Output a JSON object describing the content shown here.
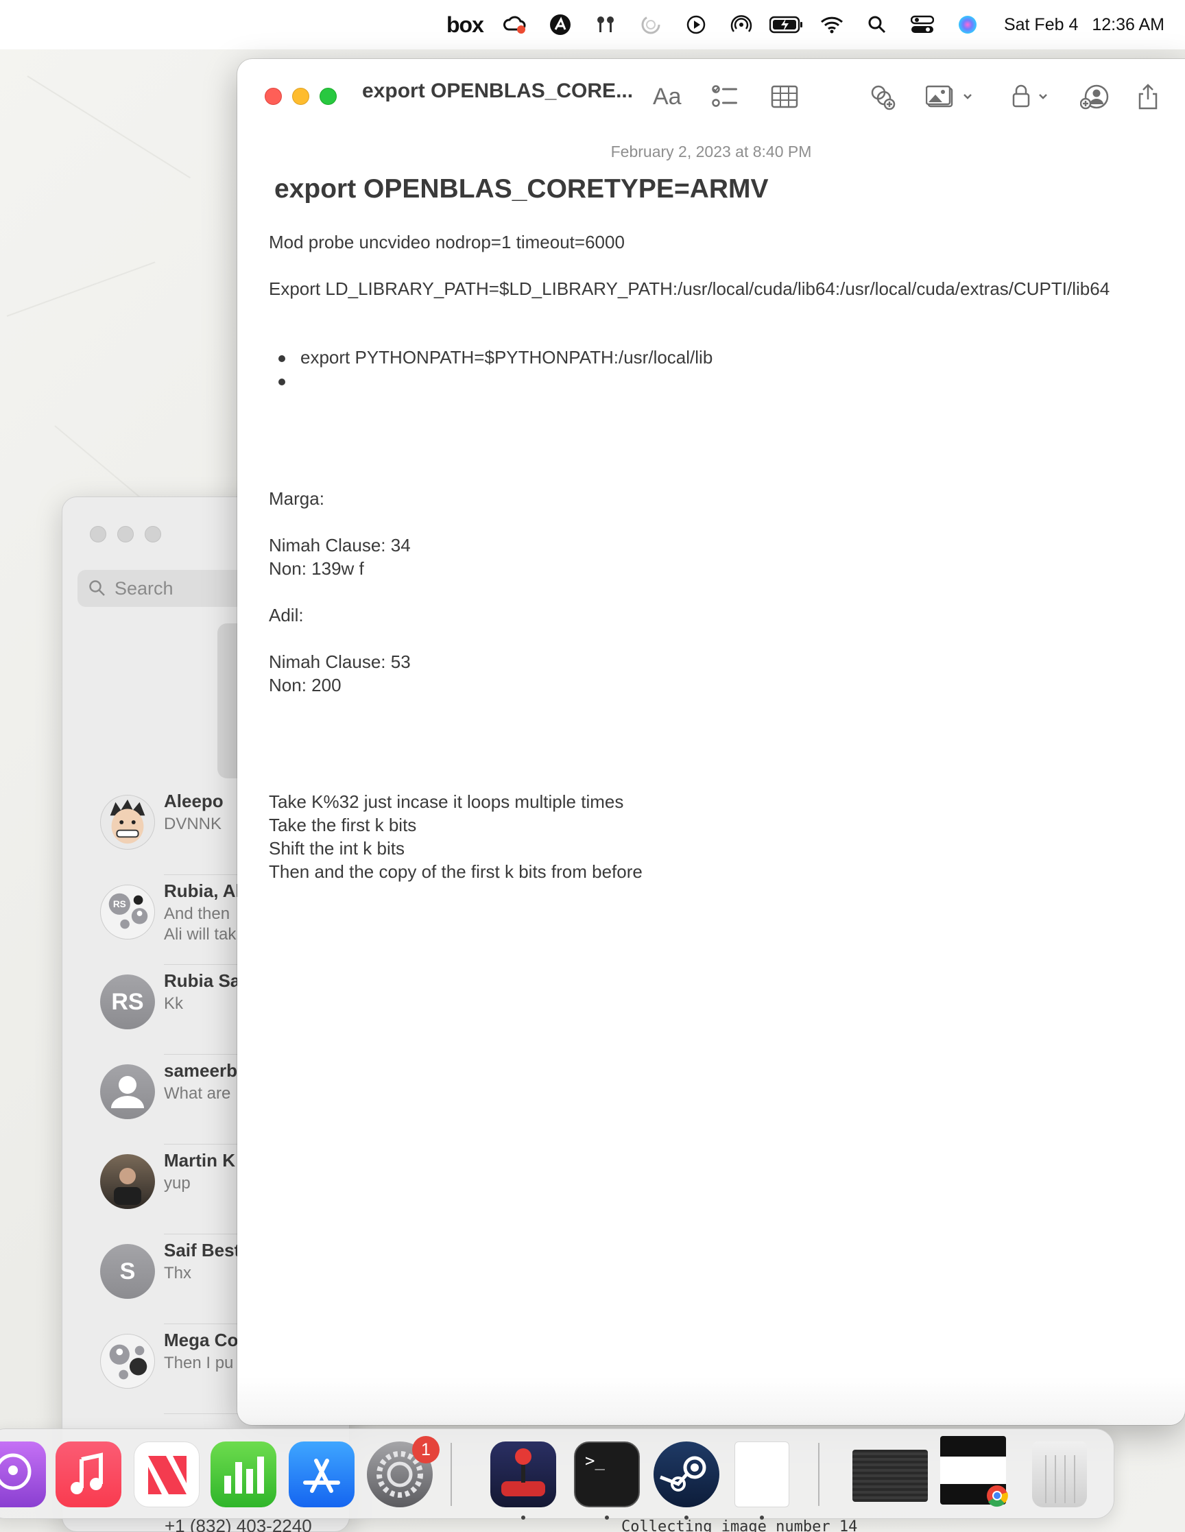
{
  "menubar": {
    "box_label": "box",
    "date": "Sat Feb 4",
    "time": "12:36 AM",
    "icons": [
      "box-icon",
      "creative-cloud-icon",
      "autodesk-icon",
      "airpods-icon",
      "progress-icon",
      "play-icon",
      "airdrop-icon",
      "battery-icon",
      "wifi-icon",
      "search-icon",
      "control-center-icon",
      "siri-icon"
    ]
  },
  "messages": {
    "search_placeholder": "Search",
    "conversations": [
      {
        "name": "Aleepo",
        "preview": "DVNNK",
        "avatar": "cartoon-avatar"
      },
      {
        "name": "Rubia, Al",
        "preview": "And then",
        "preview2": "Ali will tak",
        "avatar": "group-avatar"
      },
      {
        "name": "Rubia Sa",
        "preview": "Kk",
        "avatar_initials": "RS"
      },
      {
        "name": "sameerb",
        "preview": "What are",
        "avatar": "person-avatar"
      },
      {
        "name": "Martin K",
        "preview": "yup",
        "avatar": "photo-avatar"
      },
      {
        "name": "Saif Best",
        "preview": "Thx",
        "avatar_initials": "S"
      },
      {
        "name": "Mega Co",
        "preview": "Then I pu",
        "avatar": "group-avatar"
      }
    ],
    "phone_partial": "+1 (832) 403-2240"
  },
  "notes": {
    "window_title": "export OPENBLAS_CORE...",
    "format_label": "Aa",
    "date": "February 2, 2023 at 8:40 PM",
    "heading": "export OPENBLAS_CORETYPE=ARMV",
    "lines": {
      "l1": "Mod probe uncvideo nodrop=1 timeout=6000",
      "l2": "Export LD_LIBRARY_PATH=$LD_LIBRARY_PATH:/usr/local/cuda/lib64:/usr/local/cuda/extras/CUPTI/lib64",
      "bullet1": "export PYTHONPATH=$PYTHONPATH:/usr/local/lib",
      "marga": "Marga:",
      "nimah1": "Nimah Clause: 34",
      "non1": "Non: 139w f",
      "adil": "Adil:",
      "nimah2": "Nimah Clause: 53",
      "non2": "Non: 200",
      "take1": "Take K%32 just incase it loops multiple times",
      "take2": "Take the first k bits",
      "shift": "Shift the int k bits",
      "then": "Then and the copy of the first k bits from before"
    }
  },
  "dock": {
    "apps": [
      "podcasts-icon",
      "music-icon",
      "news-icon",
      "numbers-icon",
      "app-store-icon",
      "system-settings-icon",
      "joystick-app-icon",
      "terminal-icon",
      "steam-icon",
      "document-icon",
      "screen-thumbnail-icon",
      "browser-thumbnail-icon",
      "trash-icon"
    ],
    "settings_badge": "1",
    "terminal_prompt": ">_"
  },
  "terminal_text": "Collecting image number 14",
  "colors": {
    "close": "#fe5f57",
    "minimize": "#febc2e",
    "zoom": "#28c840",
    "badge": "#e5443b"
  }
}
